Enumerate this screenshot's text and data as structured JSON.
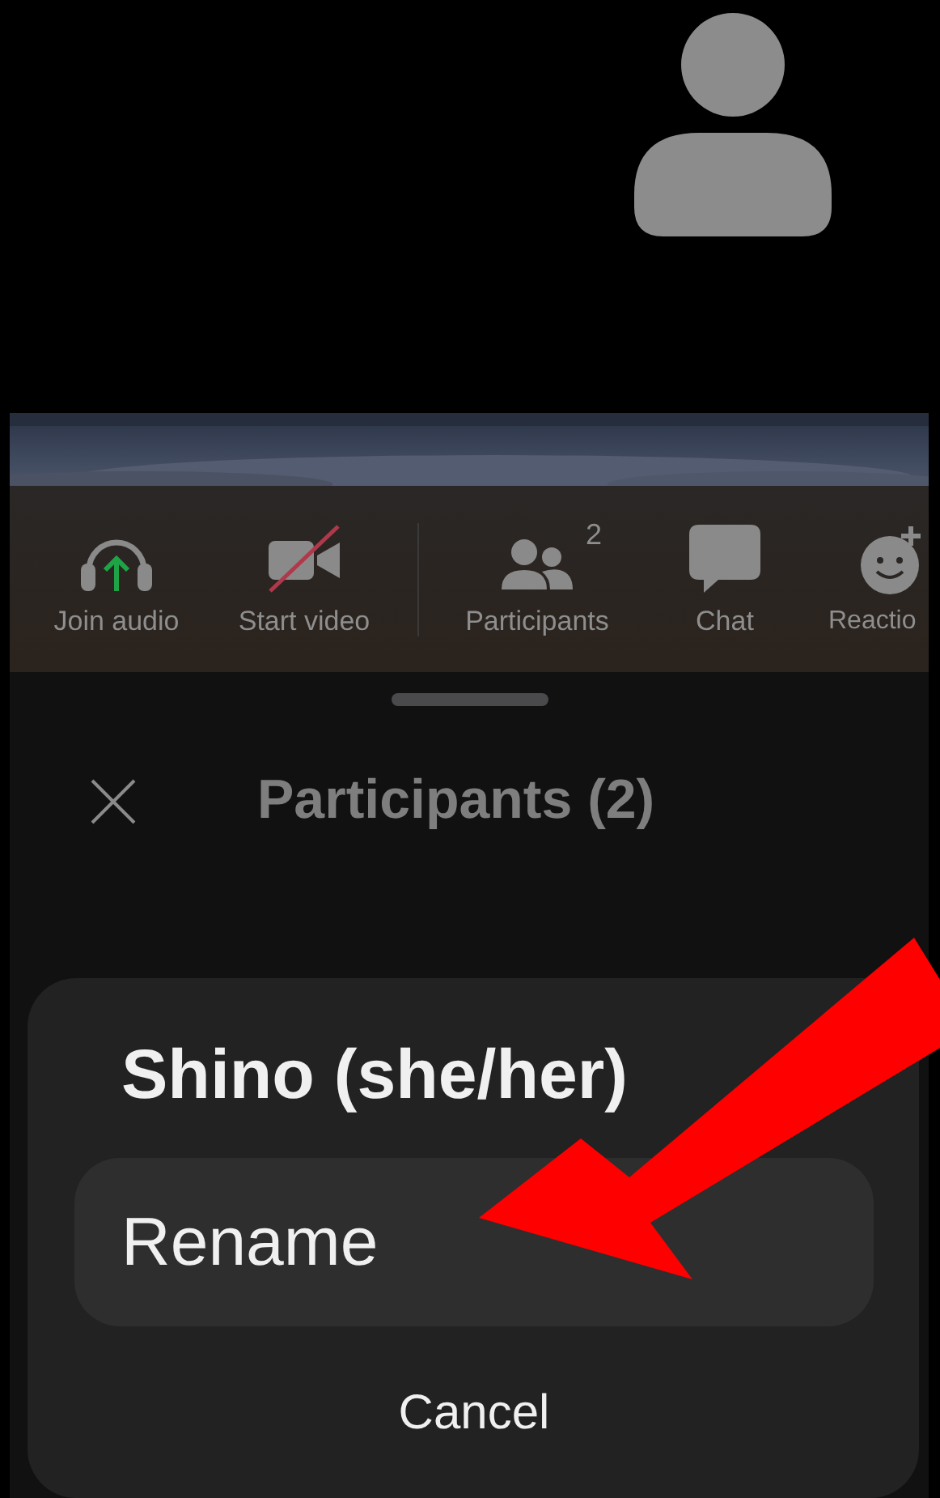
{
  "video_tile": {
    "kind": "avatar"
  },
  "toolbar": [
    {
      "kind": "headphones",
      "label": "Join audio"
    },
    {
      "kind": "video-off",
      "label": "Start video"
    },
    {
      "kind": "participants",
      "label": "Participants",
      "badge": "2"
    },
    {
      "kind": "chat",
      "label": "Chat"
    },
    {
      "kind": "reaction",
      "label": "Reactio"
    }
  ],
  "sheet": {
    "title": "Participants (2)"
  },
  "action_sheet": {
    "name": "Shino (she/her)",
    "actions": [
      {
        "label": "Rename",
        "selected": true
      }
    ],
    "cancel": "Cancel"
  }
}
